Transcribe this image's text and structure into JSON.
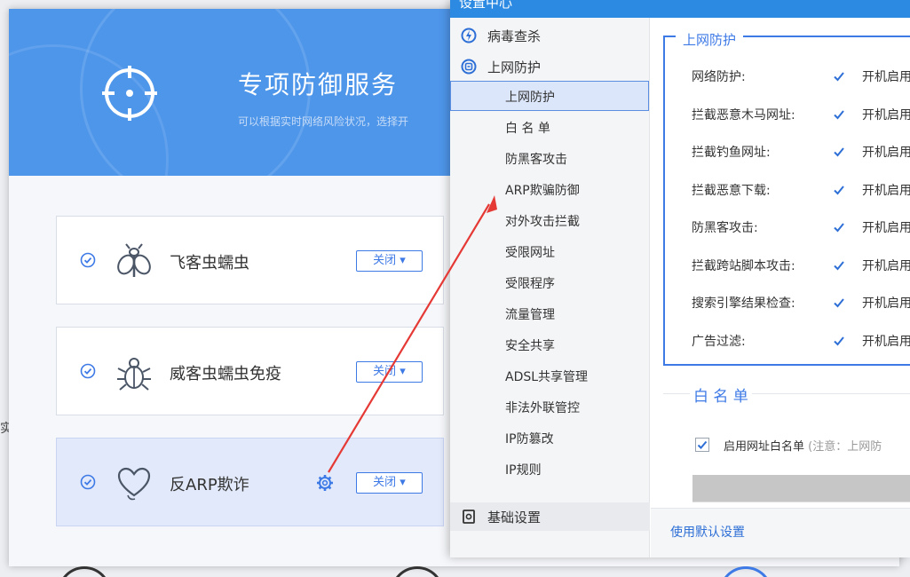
{
  "back_window": {
    "banner": {
      "title": "专项防御服务",
      "subtitle": "可以根据实时网络风险状况，选择开"
    },
    "side_text": "实",
    "cards": [
      {
        "name": "飞客虫蠕虫",
        "dropdown": "关闭 ▾",
        "selected": false
      },
      {
        "name": "威客虫蠕虫免疫",
        "dropdown": "关闭 ▾",
        "selected": false
      },
      {
        "name": "反ARP欺诈",
        "dropdown": "关闭 ▾",
        "selected": true
      }
    ]
  },
  "dialog": {
    "title": "设置中心",
    "nav": {
      "virus": "病毒查杀",
      "web": "上网防护",
      "sub_items": [
        "上网防护",
        "白 名 单",
        "防黑客攻击",
        "ARP欺骗防御",
        "对外攻击拦截",
        "受限网址",
        "受限程序",
        "流量管理",
        "安全共享",
        "ADSL共享管理",
        "非法外联管控",
        "IP防篡改",
        "IP规则"
      ],
      "active_index": 0,
      "basic": "基础设置"
    },
    "web_group": {
      "legend": "上网防护",
      "rows": [
        {
          "label": "网络防护:",
          "text": "开机启用"
        },
        {
          "label": "拦截恶意木马网址:",
          "text": "开机启用"
        },
        {
          "label": "拦截钓鱼网址:",
          "text": "开机启用"
        },
        {
          "label": "拦截恶意下载:",
          "text": "开机启用"
        },
        {
          "label": "防黑客攻击:",
          "text": "开机启用"
        },
        {
          "label": "拦截跨站脚本攻击:",
          "text": "开机启用"
        },
        {
          "label": "搜索引擎结果检查:",
          "text": "开机启用"
        },
        {
          "label": "广告过滤:",
          "text": "开机启用"
        }
      ]
    },
    "whitelist": {
      "legend": "白 名 单",
      "label": "启用网址白名单",
      "note": "(注意：上网防"
    },
    "footer": {
      "default_link": "使用默认设置"
    }
  },
  "colors": {
    "accent": "#3e7ae6",
    "banner": "#4e96ea",
    "titlebar": "#2c8ae3",
    "arrow": "#e53935"
  }
}
